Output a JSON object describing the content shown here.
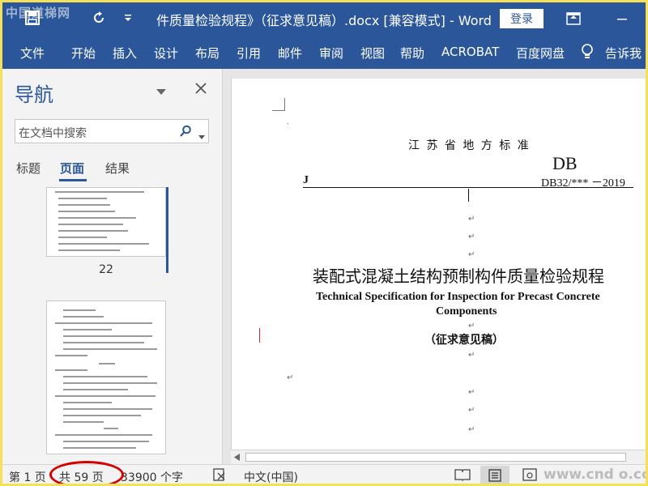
{
  "title_bar": {
    "watermark": "中国道梯网",
    "document_title": "件质量检验规程》（征求意见稿）.docx [兼容模式]  -  Word",
    "login_label": "登录"
  },
  "ribbon": {
    "tabs": [
      "文件",
      "开始",
      "插入",
      "设计",
      "布局",
      "引用",
      "邮件",
      "审阅",
      "视图",
      "帮助",
      "ACROBAT",
      "百度网盘"
    ],
    "tell_me": "告诉我"
  },
  "nav_pane": {
    "title": "导航",
    "search_placeholder": "在文档中搜索",
    "tabs": [
      "标题",
      "页面",
      "结果"
    ],
    "active_tab": "页面",
    "thumbnails": [
      {
        "page": "22"
      },
      {
        "page": ""
      }
    ]
  },
  "document": {
    "header_org": "江 苏 省 地 方 标 准",
    "db_label": "DB",
    "j_label": "J",
    "std_number": "DB32/***  －2019",
    "title_cn": "装配式混凝土结构预制构件质量检验规程",
    "title_en_line1": "Technical Specification for Inspection for Precast Concrete",
    "title_en_line2": "Components",
    "draft_label": "（征求意见稿）"
  },
  "status_bar": {
    "page_current": "第 1 页",
    "page_total": "共 59 页",
    "word_count": "33900 个字",
    "language": "中文(中国)"
  },
  "colors": {
    "accent": "#2b579a",
    "highlight_ellipse": "#d40000",
    "frame": "#f5e05a"
  }
}
